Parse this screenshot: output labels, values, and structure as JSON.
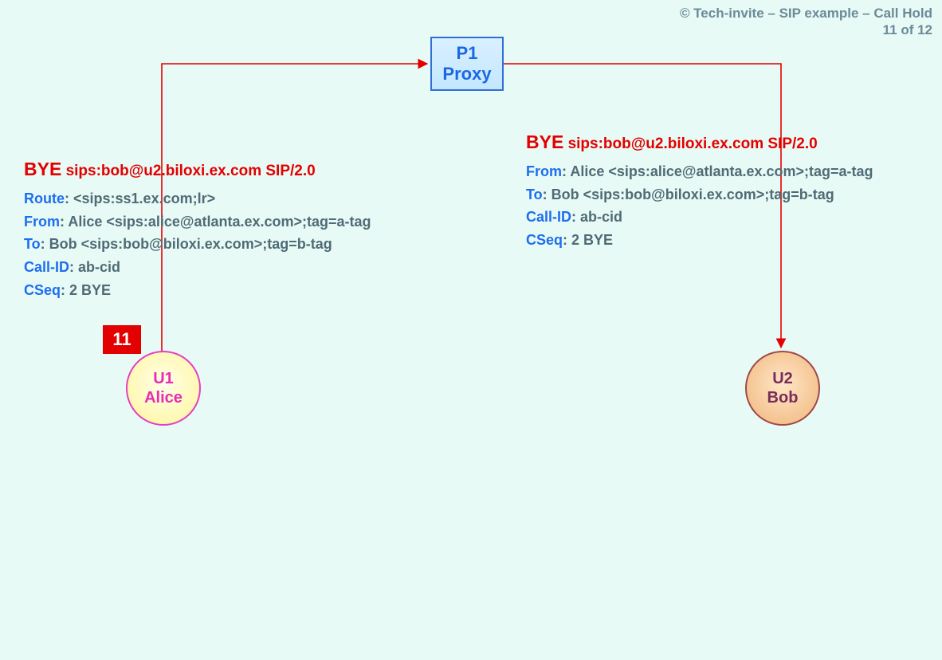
{
  "header": {
    "copyright": "© Tech-invite – SIP example – Call Hold",
    "page": "11 of 12"
  },
  "step_badge": "11",
  "nodes": {
    "proxy": {
      "id": "P1",
      "role": "Proxy"
    },
    "u1": {
      "id": "U1",
      "name": "Alice"
    },
    "u2": {
      "id": "U2",
      "name": "Bob"
    }
  },
  "messages": {
    "left": {
      "method": "BYE",
      "request_uri": "sips:bob@u2.biloxi.ex.com SIP/2.0",
      "headers": [
        {
          "k": "Route",
          "v": "<sips:ss1.ex.com;lr>"
        },
        {
          "k": "From",
          "v": "Alice <sips:alice@atlanta.ex.com>;tag=a-tag"
        },
        {
          "k": "To",
          "v": "Bob <sips:bob@biloxi.ex.com>;tag=b-tag"
        },
        {
          "k": "Call-ID",
          "v": "ab-cid"
        },
        {
          "k": "CSeq",
          "v": "2 BYE"
        }
      ]
    },
    "right": {
      "method": "BYE",
      "request_uri": "sips:bob@u2.biloxi.ex.com SIP/2.0",
      "headers": [
        {
          "k": "From",
          "v": "Alice <sips:alice@atlanta.ex.com>;tag=a-tag"
        },
        {
          "k": "To",
          "v": "Bob <sips:bob@biloxi.ex.com>;tag=b-tag"
        },
        {
          "k": "Call-ID",
          "v": "ab-cid"
        },
        {
          "k": "CSeq",
          "v": "2 BYE"
        }
      ]
    }
  }
}
